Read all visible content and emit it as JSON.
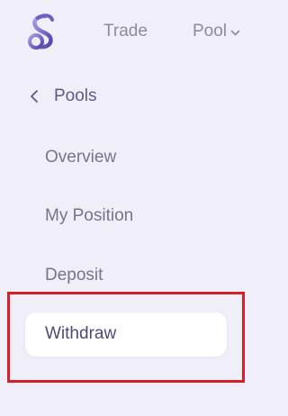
{
  "header": {
    "logo_icon": "sushi-s-logo-icon",
    "nav": {
      "trade_label": "Trade",
      "pool_label": "Pool",
      "pool_icon": "chevron-down-icon"
    }
  },
  "sidebar": {
    "back": {
      "icon": "chevron-left-icon",
      "label": "Pools"
    },
    "items": [
      {
        "label": "Overview",
        "active": false
      },
      {
        "label": "My Position",
        "active": false
      },
      {
        "label": "Deposit",
        "active": false
      },
      {
        "label": "Withdraw",
        "active": true
      }
    ]
  },
  "colors": {
    "background": "#f0eef9",
    "logo_gradient_start": "#8b7fd8",
    "logo_gradient_end": "#4f43a7",
    "active_item_bg": "#ffffff",
    "highlight_border": "#d71f2a",
    "nav_text": "#8c8c9c",
    "active_text": "#4d4a7a"
  }
}
